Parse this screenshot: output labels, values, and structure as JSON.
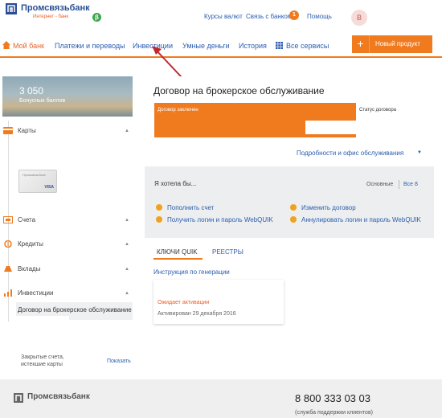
{
  "header": {
    "logo_text": "Промсвязьбанк",
    "logo_sub": "Интернет - банк",
    "beta": "β",
    "links": [
      "Курсы валют",
      "Связь с банком",
      "Помощь"
    ],
    "notification_count": "1",
    "avatar_letter": "В"
  },
  "nav": {
    "items": [
      "Мой банк",
      "Платежи и переводы",
      "Инвестиции",
      "Умные деньги",
      "История",
      "Все сервисы"
    ],
    "new_product_plus": "+",
    "new_product_label": "Новый продукт"
  },
  "bonus": {
    "points": "3 050",
    "label": "Бонусных баллов"
  },
  "sidebar": {
    "items": [
      "Карты",
      "Счета",
      "Кредиты",
      "Вклады",
      "Инвестиции"
    ],
    "card_brand": "Промсвязьбанк",
    "card_network": "VISA",
    "selected_product": "Договор на брокерское обслуживание",
    "closed_label": "Закрытые счета, истекшие карты",
    "show_label": "Показать"
  },
  "contract": {
    "title": "Договор на брокерское обслуживание",
    "concluded_label": "Договор заключен",
    "status_label": "Статус договора",
    "details_link": "Подробности и офис обслуживания"
  },
  "actions_block": {
    "title": "Я хотела бы...",
    "filter_basic": "Основные",
    "filter_all": "Все 8",
    "actions": [
      "Пополнить счет",
      "Получить логин и пароль WebQUIK",
      "Изменить договор",
      "Аннулировать логин и пароль WebQUIK"
    ]
  },
  "keys_block": {
    "tabs": [
      "КЛЮЧИ QUIK",
      "РЕЕСТРЫ"
    ],
    "instruction_link": "Инструкция по генерации",
    "key_status": "Ожидает активации",
    "key_activated": "Активирован 29 декабря 2016"
  },
  "footer": {
    "logo_text": "Промсвязьбанк",
    "phone": "8 800 333 03 03",
    "support": "(служба поддержки клиентов)"
  },
  "colors": {
    "accent": "#f07b1f",
    "link": "#2a5db0",
    "brand": "#2a4f93"
  }
}
